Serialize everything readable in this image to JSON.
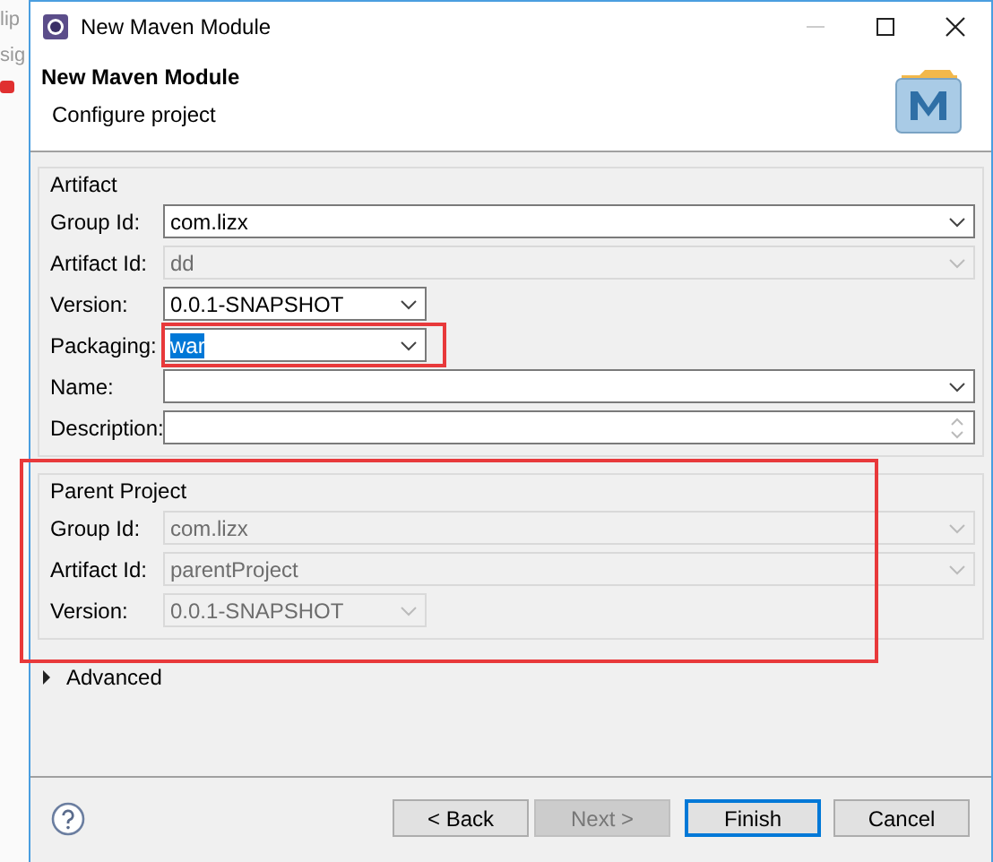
{
  "background_window": {
    "texts": [
      "lip",
      "sig"
    ]
  },
  "window": {
    "title": "New Maven Module"
  },
  "header": {
    "title": "New Maven Module",
    "subtitle": "Configure project"
  },
  "artifact": {
    "title": "Artifact",
    "fields": [
      {
        "label": "Group Id:",
        "value": "com.lizx",
        "disabled": false,
        "kind": "combo"
      },
      {
        "label": "Artifact Id:",
        "value": "dd",
        "disabled": true,
        "kind": "combo"
      },
      {
        "label": "Version:",
        "value": "0.0.1-SNAPSHOT",
        "disabled": false,
        "kind": "short_combo"
      },
      {
        "label": "Packaging:",
        "value": "war",
        "disabled": false,
        "kind": "short_combo",
        "selected_text": true,
        "highlight": true
      },
      {
        "label": "Name:",
        "disabled": false,
        "kind": "combo"
      },
      {
        "label": "Description:",
        "disabled": false,
        "kind": "spinner"
      }
    ]
  },
  "parent_project": {
    "title": "Parent Project",
    "highlight": true,
    "fields": [
      {
        "label": "Group Id:",
        "value": "com.lizx",
        "disabled": true,
        "kind": "combo"
      },
      {
        "label": "Artifact Id:",
        "value": "parentProject",
        "disabled": true,
        "kind": "combo"
      },
      {
        "label": "Version:",
        "value": "0.0.1-SNAPSHOT",
        "disabled": true,
        "kind": "short_combo"
      }
    ]
  },
  "advanced": {
    "label": "Advanced",
    "expanded": false
  },
  "buttons": [
    {
      "label": "< Back",
      "disabled": false,
      "default": false
    },
    {
      "label": "Next >",
      "disabled": true,
      "default": false
    },
    {
      "label": "Finish",
      "disabled": false,
      "default": true
    },
    {
      "label": "Cancel",
      "disabled": false,
      "default": false
    }
  ]
}
